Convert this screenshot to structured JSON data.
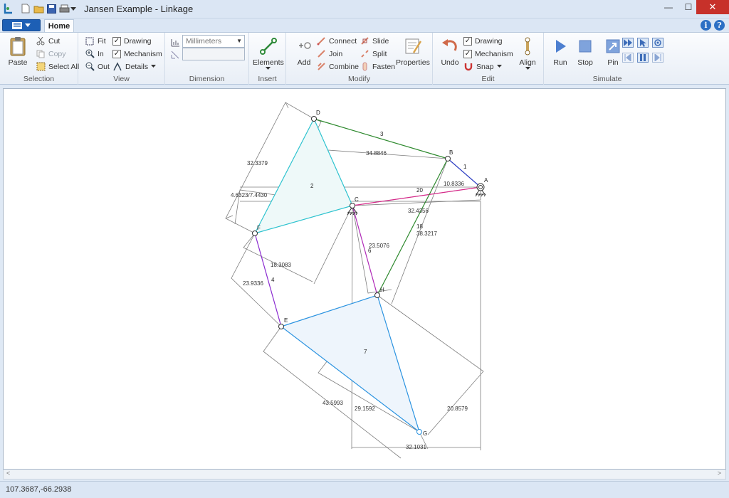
{
  "window": {
    "title": "Jansen Example - Linkage",
    "minimize": "—",
    "maximize": "☐",
    "close": "✕"
  },
  "tabs": {
    "home": "Home"
  },
  "ribbon": {
    "selection": {
      "label": "Selection",
      "paste": "Paste",
      "cut": "Cut",
      "copy": "Copy",
      "select_all": "Select All"
    },
    "view": {
      "label": "View",
      "fit": "Fit",
      "in": "In",
      "out": "Out",
      "drawing": "Drawing",
      "mechanism": "Mechanism",
      "details": "Details"
    },
    "dimension": {
      "label": "Dimension",
      "units": "Millimeters",
      "value": ""
    },
    "insert": {
      "label": "Insert",
      "elements": "Elements"
    },
    "modify": {
      "label": "Modify",
      "add": "Add",
      "connect": "Connect",
      "join": "Join",
      "combine": "Combine",
      "slide": "Slide",
      "split": "Split",
      "fasten": "Fasten",
      "properties": "Properties"
    },
    "edit": {
      "label": "Edit",
      "undo": "Undo",
      "drawing": "Drawing",
      "mechanism": "Mechanism",
      "snap": "Snap",
      "align": "Align"
    },
    "simulate": {
      "label": "Simulate",
      "run": "Run",
      "stop": "Stop",
      "pin": "Pin"
    }
  },
  "drawing": {
    "nodes": [
      {
        "id": "D",
        "label": "D"
      },
      {
        "id": "B",
        "label": "B"
      },
      {
        "id": "A",
        "label": "A"
      },
      {
        "id": "C",
        "label": "C"
      },
      {
        "id": "F",
        "label": "F"
      },
      {
        "id": "H",
        "label": "H"
      },
      {
        "id": "E",
        "label": "E"
      },
      {
        "id": "G",
        "label": "G"
      }
    ],
    "link_labels": [
      {
        "id": "l3",
        "text": "3"
      },
      {
        "id": "l1",
        "text": "1"
      },
      {
        "id": "l2",
        "text": "2"
      },
      {
        "id": "l20",
        "text": "20"
      },
      {
        "id": "l18",
        "text": "18"
      },
      {
        "id": "l6",
        "text": "6"
      },
      {
        "id": "l4",
        "text": "4"
      },
      {
        "id": "l7",
        "text": "7"
      }
    ],
    "dimensions": [
      {
        "id": "d1",
        "text": "34.8846"
      },
      {
        "id": "d2",
        "text": "32.3379"
      },
      {
        "id": "d3",
        "text": "10.8336"
      },
      {
        "id": "d4",
        "text": "4.6323/7.4430"
      },
      {
        "id": "d5",
        "text": "32.4356"
      },
      {
        "id": "d6",
        "text": "38.3217"
      },
      {
        "id": "d7",
        "text": "23.5076"
      },
      {
        "id": "d8",
        "text": "18.3083"
      },
      {
        "id": "d9",
        "text": "23.9336"
      },
      {
        "id": "d10",
        "text": "43.5993"
      },
      {
        "id": "d11",
        "text": "29.1592"
      },
      {
        "id": "d12",
        "text": "20.8579"
      },
      {
        "id": "d13",
        "text": "32.1031"
      }
    ]
  },
  "status": {
    "coordinates": "107.3687,-66.2938"
  }
}
